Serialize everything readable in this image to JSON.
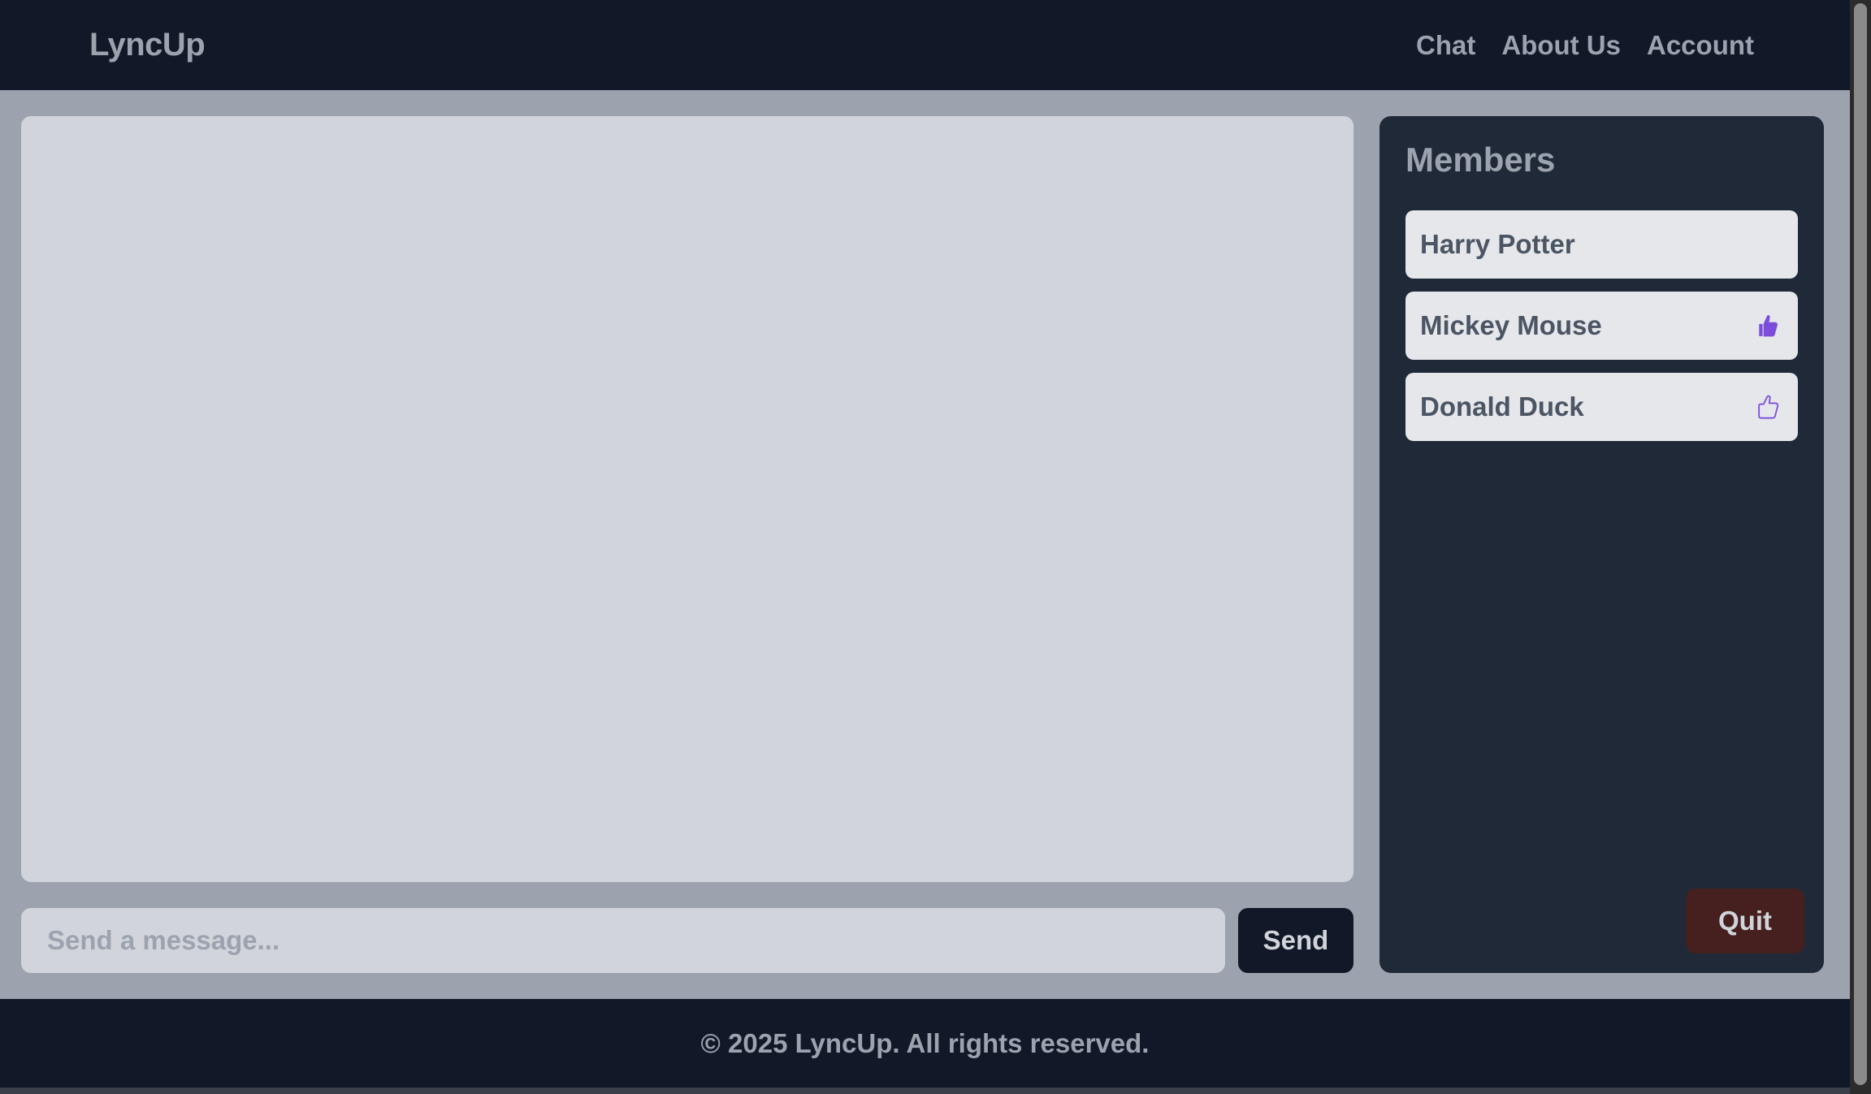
{
  "navbar": {
    "brand": "LyncUp",
    "links": [
      "Chat",
      "About Us",
      "Account"
    ]
  },
  "chat": {
    "input_placeholder": "Send a message...",
    "send_label": "Send"
  },
  "members": {
    "title": "Members",
    "list": [
      {
        "name": "Harry Potter",
        "icon": "none"
      },
      {
        "name": "Mickey Mouse",
        "icon": "thumbs-up-filled-icon"
      },
      {
        "name": "Donald Duck",
        "icon": "thumbs-up-outline-icon"
      }
    ],
    "quit_label": "Quit"
  },
  "footer": {
    "text": "© 2025 LyncUp. All rights reserved."
  },
  "colors": {
    "accent": "#7c4ddb",
    "navbar_bg": "#111827",
    "panel_bg": "#1f2937",
    "quit_bg": "#45201f"
  }
}
